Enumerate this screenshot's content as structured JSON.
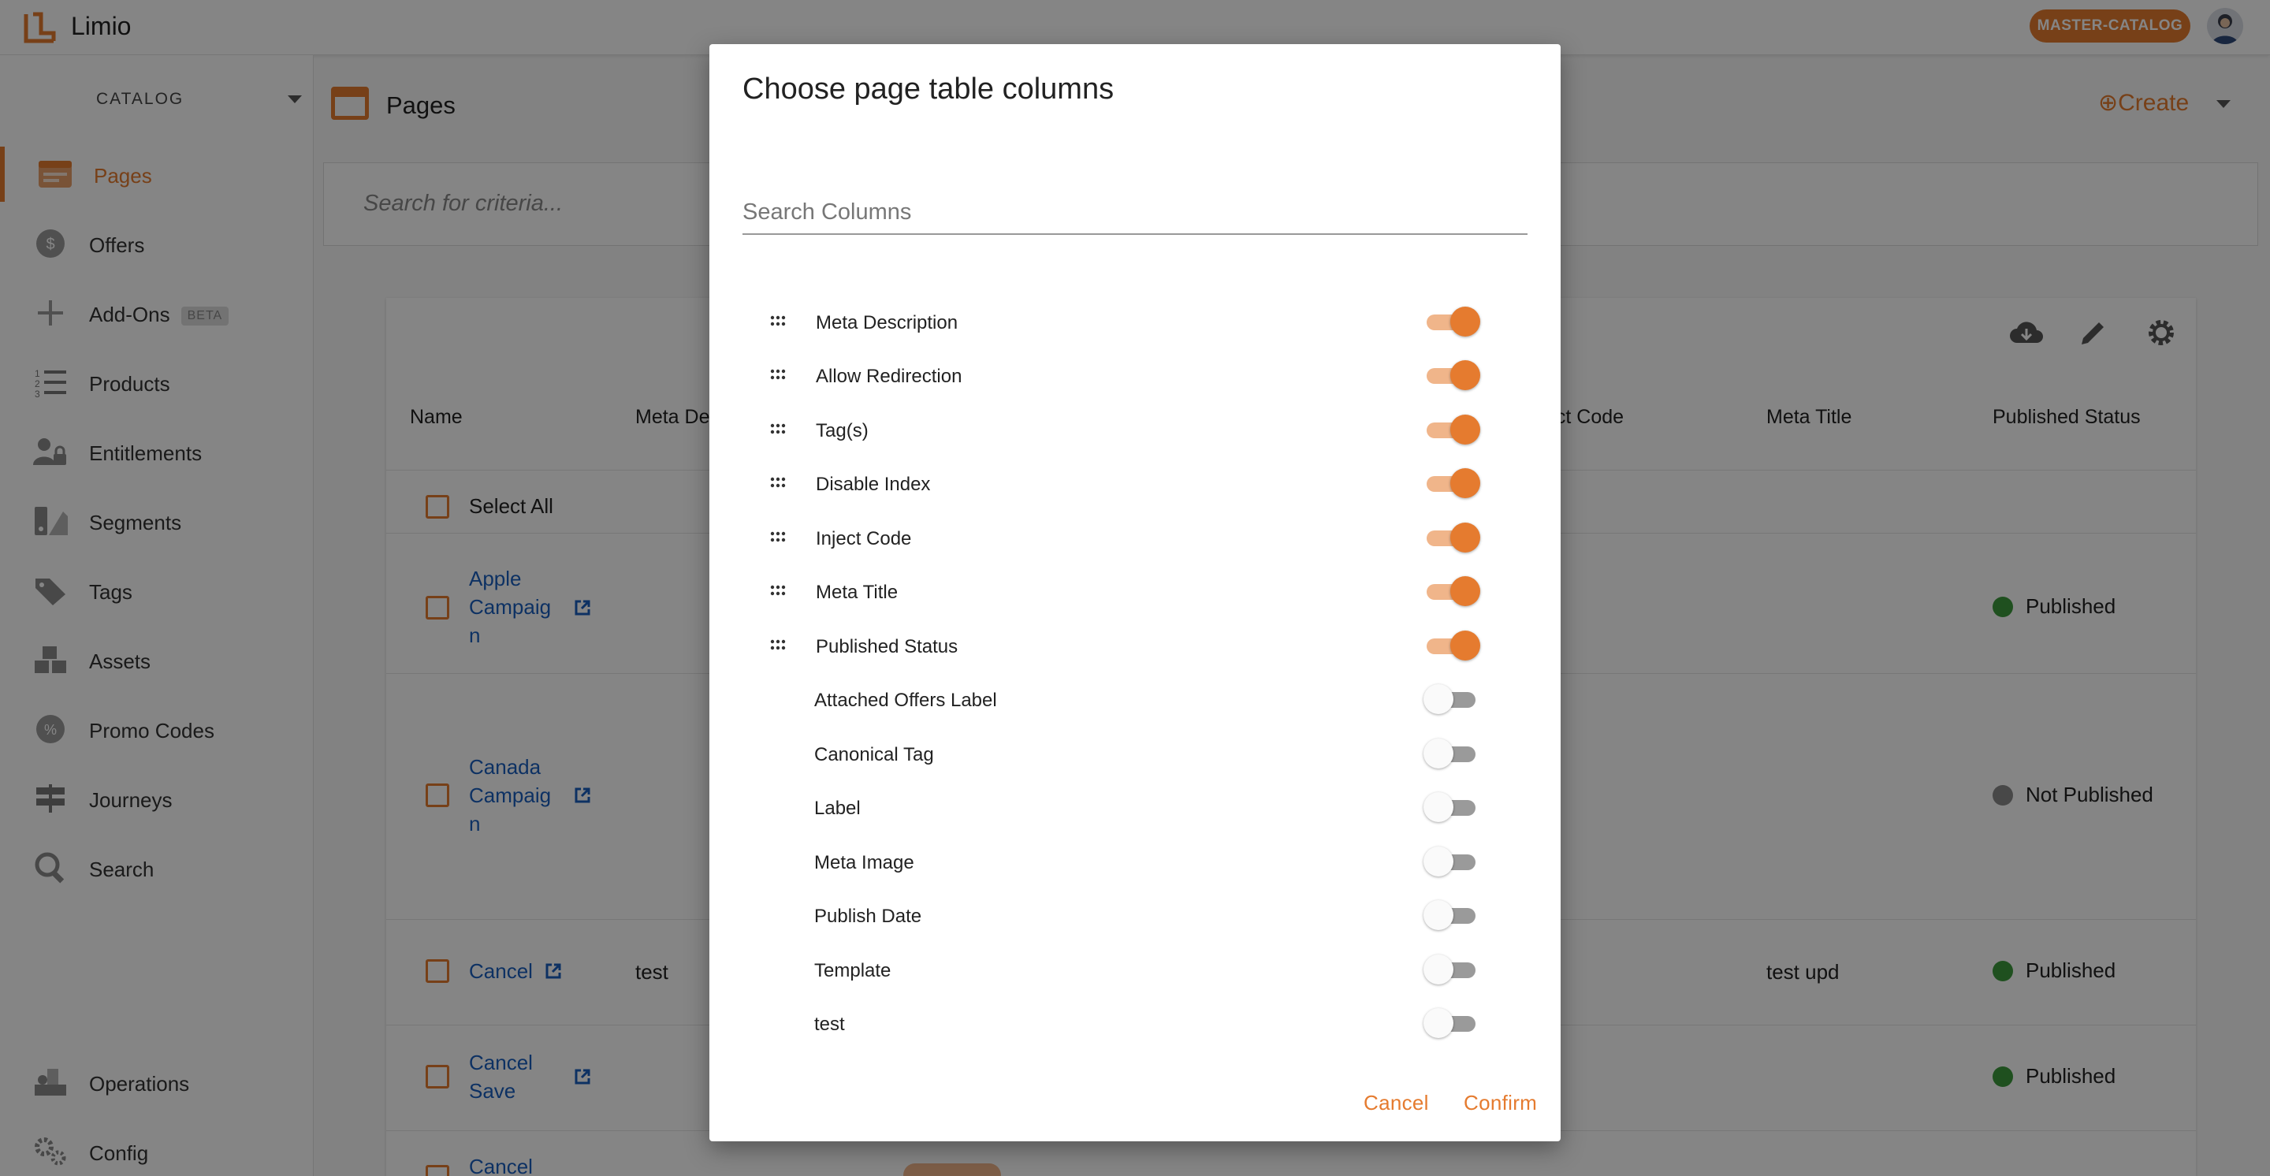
{
  "app": {
    "brand": "Limio",
    "catalog_badge": "MASTER-CATALOG"
  },
  "sidebar": {
    "catalog_label": "CATALOG",
    "items": [
      {
        "label": "Pages",
        "icon": "pages-icon",
        "active": true
      },
      {
        "label": "Offers",
        "icon": "dollar-icon"
      },
      {
        "label": "Add-Ons",
        "icon": "plus-icon",
        "badge": "BETA"
      },
      {
        "label": "Products",
        "icon": "numbered-list-icon"
      },
      {
        "label": "Entitlements",
        "icon": "user-lock-icon"
      },
      {
        "label": "Segments",
        "icon": "segments-icon"
      },
      {
        "label": "Tags",
        "icon": "tag-icon"
      },
      {
        "label": "Assets",
        "icon": "boxes-icon"
      },
      {
        "label": "Promo Codes",
        "icon": "percent-badge-icon"
      },
      {
        "label": "Journeys",
        "icon": "signpost-icon"
      },
      {
        "label": "Search",
        "icon": "search-icon"
      }
    ],
    "bottom_items": [
      {
        "label": "Operations",
        "icon": "operations-icon"
      },
      {
        "label": "Config",
        "icon": "gears-icon"
      }
    ]
  },
  "main": {
    "title": "Pages",
    "create_label": "⊕Create",
    "search_placeholder": "Search for criteria...",
    "table": {
      "columns": [
        "Name",
        "Meta De",
        "ect Code",
        "Meta Title",
        "Published Status"
      ],
      "select_all": "Select All",
      "rows": [
        {
          "name": "Apple Campaig n",
          "meta_description": "",
          "meta_title": "",
          "status": "Published"
        },
        {
          "name": "Canada Campaig n",
          "meta_description": "",
          "meta_title": "",
          "status": "Not Published"
        },
        {
          "name": "Cancel",
          "meta_description": "test",
          "meta_title": "test upd",
          "status": "Published"
        },
        {
          "name": "Cancel Save",
          "meta_description": "",
          "meta_title": "",
          "status": "Published"
        },
        {
          "name": "Cancel",
          "meta_description": "",
          "meta_title": "",
          "status": ""
        }
      ]
    }
  },
  "dialog": {
    "title": "Choose page table columns",
    "search_placeholder": "Search Columns",
    "columns": [
      {
        "label": "Meta Description",
        "enabled": true,
        "draggable": true
      },
      {
        "label": "Allow Redirection",
        "enabled": true,
        "draggable": true
      },
      {
        "label": "Tag(s)",
        "enabled": true,
        "draggable": true
      },
      {
        "label": "Disable Index",
        "enabled": true,
        "draggable": true
      },
      {
        "label": "Inject Code",
        "enabled": true,
        "draggable": true
      },
      {
        "label": "Meta Title",
        "enabled": true,
        "draggable": true
      },
      {
        "label": "Published Status",
        "enabled": true,
        "draggable": true
      },
      {
        "label": "Attached Offers Label",
        "enabled": false,
        "draggable": false
      },
      {
        "label": "Canonical Tag",
        "enabled": false,
        "draggable": false
      },
      {
        "label": "Label",
        "enabled": false,
        "draggable": false
      },
      {
        "label": "Meta Image",
        "enabled": false,
        "draggable": false
      },
      {
        "label": "Publish Date",
        "enabled": false,
        "draggable": false
      },
      {
        "label": "Template",
        "enabled": false,
        "draggable": false
      },
      {
        "label": "test",
        "enabled": false,
        "draggable": false
      }
    ],
    "cancel_label": "Cancel",
    "confirm_label": "Confirm"
  },
  "colors": {
    "accent": "#e57b2f",
    "link": "#1a5fbf",
    "published": "#3c9a3c",
    "unpublished": "#8a8a8a"
  }
}
